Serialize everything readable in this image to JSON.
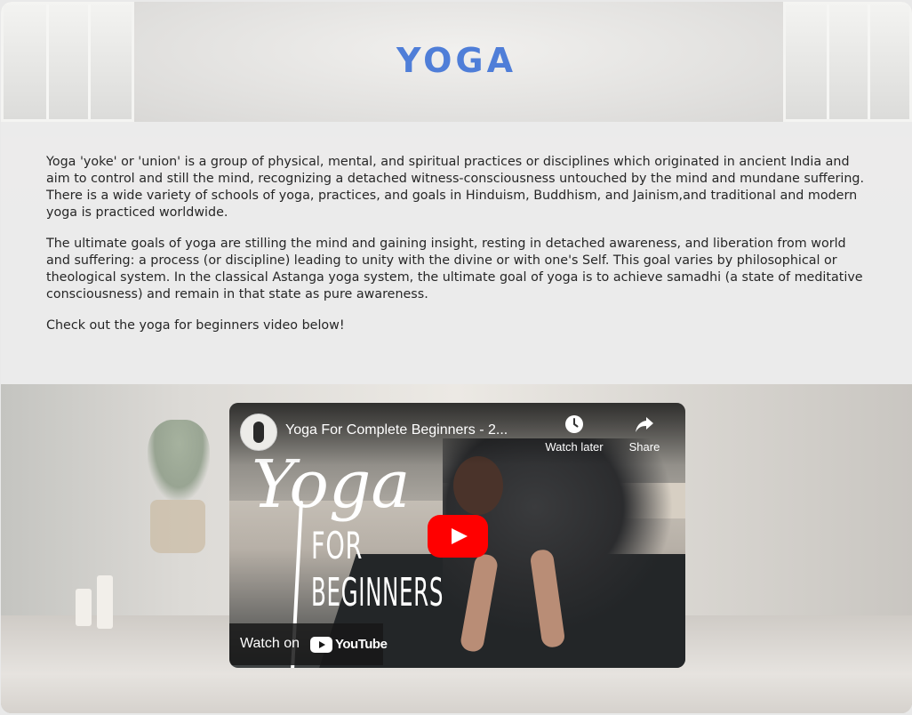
{
  "header": {
    "title": "YOGA"
  },
  "article": {
    "paragraphs": [
      "Yoga 'yoke' or 'union' is a group of physical, mental, and spiritual practices or disciplines which originated in ancient India and aim to control and still the mind, recognizing a detached witness-consciousness untouched by the mind and mundane suffering.",
      "There is a wide variety of schools of yoga, practices, and goals in Hinduism, Buddhism, and Jainism,and traditional and modern yoga is practiced worldwide.",
      "The ultimate goals of yoga are stilling the mind and gaining insight, resting in detached awareness, and liberation from world and suffering: a process (or discipline) leading to unity with the divine or with one's Self. This goal varies by philosophical or theological system. In the classical Astanga yoga system, the ultimate goal of yoga is to achieve samadhi (a state of meditative consciousness) and remain in that state as pure awareness.",
      "Check out the yoga for beginners video below!"
    ]
  },
  "video": {
    "title": "Yoga For Complete Beginners - 2...",
    "watch_later_label": "Watch later",
    "share_label": "Share",
    "watch_on_label": "Watch on",
    "youtube_wordmark": "YouTube",
    "thumbnail_script_text": "Yoga",
    "thumbnail_for_text": "FOR",
    "thumbnail_beginners_text": "BEGINNERS",
    "icons": {
      "watch_later": "clock-icon",
      "share": "share-arrow-icon",
      "play": "play-icon"
    }
  },
  "colors": {
    "title": "#4f7ed8",
    "play_button": "#ff0000",
    "text": "#262626"
  }
}
